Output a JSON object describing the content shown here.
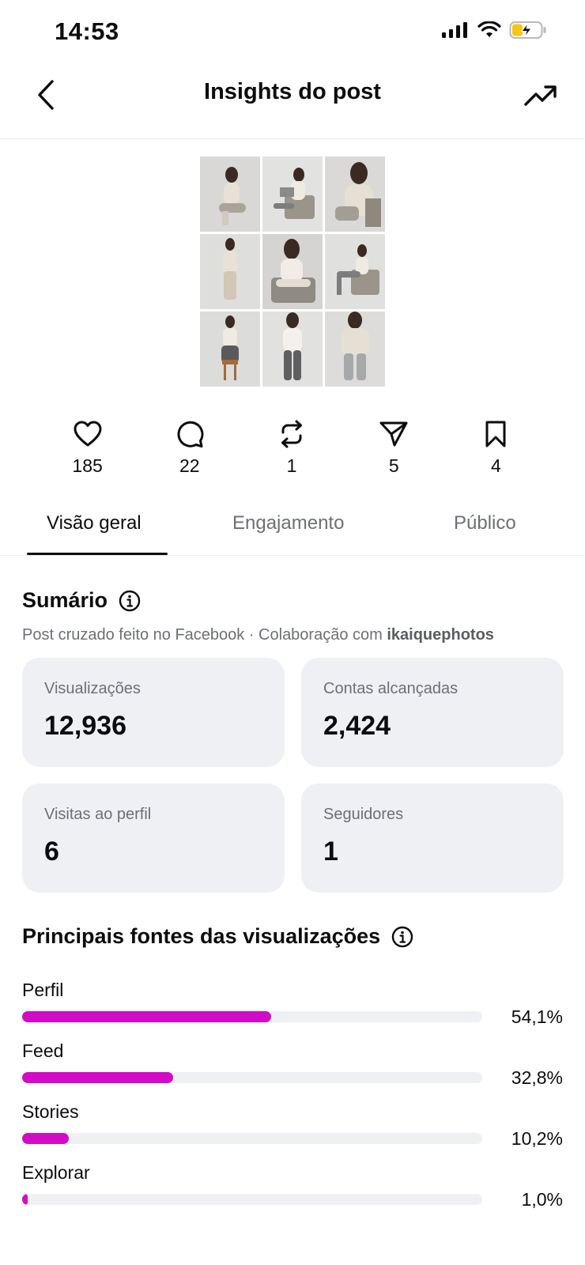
{
  "status_bar": {
    "time": "14:53"
  },
  "header": {
    "title": "Insights do post"
  },
  "metrics": [
    {
      "name": "likes",
      "icon": "heart-icon",
      "value": "185"
    },
    {
      "name": "comments",
      "icon": "comment-icon",
      "value": "22"
    },
    {
      "name": "reposts",
      "icon": "repost-icon",
      "value": "1"
    },
    {
      "name": "shares",
      "icon": "send-icon",
      "value": "5"
    },
    {
      "name": "saves",
      "icon": "bookmark-icon",
      "value": "4"
    }
  ],
  "tabs": [
    {
      "label": "Visão geral",
      "active": true
    },
    {
      "label": "Engajamento",
      "active": false
    },
    {
      "label": "Público",
      "active": false
    }
  ],
  "summary": {
    "title": "Sumário",
    "subtitle_prefix": "Post cruzado feito no Facebook · Colaboração com ",
    "collaborator": "ikaiquephotos",
    "cards": [
      {
        "label": "Visualizações",
        "value": "12,936"
      },
      {
        "label": "Contas alcançadas",
        "value": "2,424"
      },
      {
        "label": "Visitas ao perfil",
        "value": "6"
      },
      {
        "label": "Seguidores",
        "value": "1"
      }
    ]
  },
  "sources": {
    "title": "Principais fontes das visualizações",
    "accent_color": "#d10bc6",
    "items": [
      {
        "label": "Perfil",
        "value_text": "54,1%",
        "fraction": 0.541
      },
      {
        "label": "Feed",
        "value_text": "32,8%",
        "fraction": 0.328
      },
      {
        "label": "Stories",
        "value_text": "10,2%",
        "fraction": 0.102
      },
      {
        "label": "Explorar",
        "value_text": "1,0%",
        "fraction": 0.01
      }
    ]
  }
}
